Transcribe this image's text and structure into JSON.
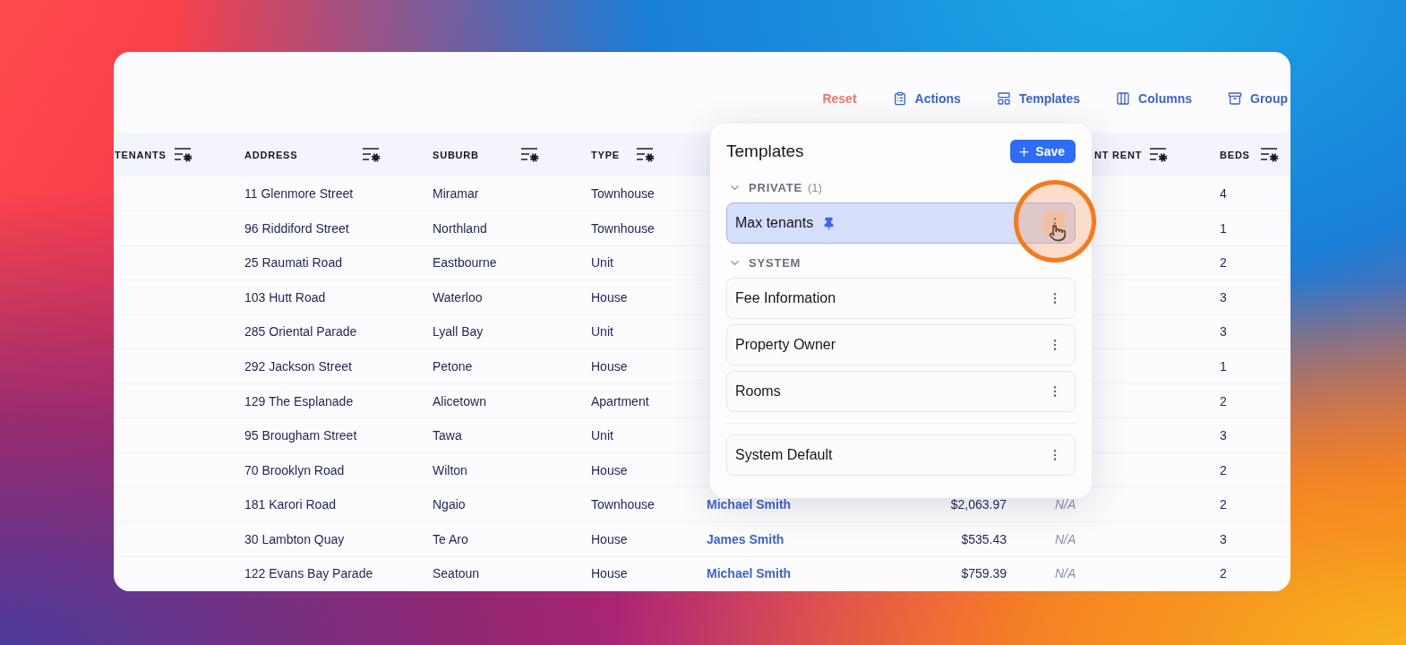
{
  "toolbar": [
    {
      "kind": "reset",
      "label": "Reset"
    },
    {
      "kind": "actions",
      "label": "Actions"
    },
    {
      "kind": "templates",
      "label": "Templates"
    },
    {
      "kind": "columns",
      "label": "Columns"
    },
    {
      "kind": "group",
      "label": "Group"
    }
  ],
  "table": {
    "columns": [
      {
        "label": "TENANTS",
        "kind": "tenants"
      },
      {
        "label": "ADDRESS",
        "kind": "address"
      },
      {
        "label": "SUBURB",
        "kind": "suburb"
      },
      {
        "label": "TYPE",
        "kind": "type"
      },
      {
        "label": "NT RENT",
        "kind": "rent"
      },
      {
        "label": "BEDS",
        "kind": "beds"
      }
    ],
    "rows": [
      {
        "address": "11 Glenmore Street",
        "suburb": "Miramar",
        "type": "Townhouse",
        "beds": "4"
      },
      {
        "address": "96 Riddiford Street",
        "suburb": "Northland",
        "type": "Townhouse",
        "beds": "1"
      },
      {
        "address": "25 Raumati Road",
        "suburb": "Eastbourne",
        "type": "Unit",
        "beds": "2"
      },
      {
        "address": "103 Hutt Road",
        "suburb": "Waterloo",
        "type": "House",
        "beds": "3"
      },
      {
        "address": "285 Oriental Parade",
        "suburb": "Lyall Bay",
        "type": "Unit",
        "beds": "3"
      },
      {
        "address": "292 Jackson Street",
        "suburb": "Petone",
        "type": "House",
        "beds": "1"
      },
      {
        "address": "129 The Esplanade",
        "suburb": "Alicetown",
        "type": "Apartment",
        "beds": "2"
      },
      {
        "address": "95 Brougham Street",
        "suburb": "Tawa",
        "type": "Unit",
        "beds": "3"
      },
      {
        "address": "70 Brooklyn Road",
        "suburb": "Wilton",
        "type": "House",
        "beds": "2"
      },
      {
        "address": "181 Karori Road",
        "suburb": "Ngaio",
        "type": "Townhouse",
        "owner": "Michael Smith",
        "amount": "$2,063.97",
        "rent": "N/A",
        "beds": "2"
      },
      {
        "address": "30 Lambton Quay",
        "suburb": "Te Aro",
        "type": "House",
        "owner": "James Smith",
        "amount": "$535.43",
        "rent": "N/A",
        "beds": "3"
      },
      {
        "address": "122 Evans Bay Parade",
        "suburb": "Seatoun",
        "type": "House",
        "owner": "Michael Smith",
        "amount": "$759.39",
        "rent": "N/A",
        "beds": "2"
      }
    ]
  },
  "templates_popup": {
    "title": "Templates",
    "save_button": "Save",
    "groups": [
      {
        "heading": "PRIVATE",
        "count": "(1)",
        "expanded": true,
        "items": [
          {
            "name": "Max tenants",
            "pinned": true,
            "selected": true
          }
        ]
      },
      {
        "heading": "SYSTEM",
        "expanded": true,
        "items": [
          {
            "name": "Fee Information",
            "pinned": false,
            "selected": false
          },
          {
            "name": "Property Owner",
            "pinned": false,
            "selected": false
          },
          {
            "name": "Rooms",
            "pinned": false,
            "selected": false
          }
        ]
      },
      {
        "items": [
          {
            "name": "System Default",
            "pinned": false,
            "selected": false
          }
        ]
      }
    ]
  }
}
